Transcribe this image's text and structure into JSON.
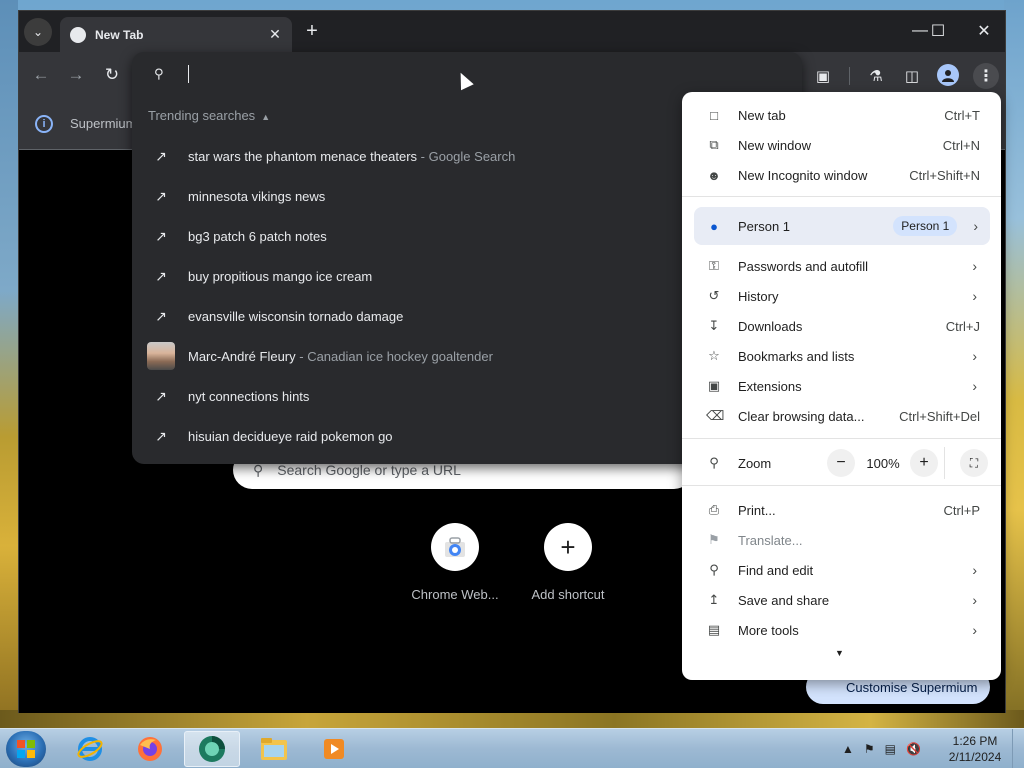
{
  "browser": {
    "tab": {
      "title": "New Tab"
    },
    "info_bar": {
      "text": "Supermium"
    },
    "colors": {
      "dark": "#202124",
      "toolbar": "#35363a",
      "accent": "#8ab4f8"
    }
  },
  "omnibox": {
    "trending_heading": "Trending searches",
    "suggestions": [
      {
        "icon": "trending-icon",
        "text": "star wars the phantom menace theaters",
        "sub": " - Google Search"
      },
      {
        "icon": "trending-icon",
        "text": "minnesota vikings news",
        "sub": ""
      },
      {
        "icon": "trending-icon",
        "text": "bg3 patch 6 patch notes",
        "sub": ""
      },
      {
        "icon": "trending-icon",
        "text": "buy propitious mango ice cream",
        "sub": ""
      },
      {
        "icon": "trending-icon",
        "text": "evansville wisconsin tornado damage",
        "sub": ""
      },
      {
        "icon": "person-thumbnail",
        "text": "Marc-André Fleury",
        "sub": " - Canadian ice hockey goaltender"
      },
      {
        "icon": "trending-icon",
        "text": "nyt connections hints",
        "sub": ""
      },
      {
        "icon": "trending-icon",
        "text": "hisuian decidueye raid pokemon go",
        "sub": ""
      }
    ]
  },
  "ntp": {
    "search_placeholder": "Search Google or type a URL",
    "shortcuts": [
      {
        "label": "Chrome Web..."
      },
      {
        "label": "Add shortcut"
      }
    ],
    "customise_label": "Customise Supermium"
  },
  "menu": {
    "items_top": [
      {
        "icon": "new-tab-icon",
        "label": "New tab",
        "shortcut": "Ctrl+T"
      },
      {
        "icon": "new-window-icon",
        "label": "New window",
        "shortcut": "Ctrl+N"
      },
      {
        "icon": "incognito-icon",
        "label": "New Incognito window",
        "shortcut": "Ctrl+Shift+N"
      }
    ],
    "person": {
      "label": "Person 1",
      "badge": "Person 1"
    },
    "items_mid": [
      {
        "icon": "key-icon",
        "label": "Passwords and autofill",
        "shortcut": ""
      },
      {
        "icon": "history-icon",
        "label": "History",
        "shortcut": ""
      },
      {
        "icon": "download-icon",
        "label": "Downloads",
        "shortcut": "Ctrl+J"
      },
      {
        "icon": "star-icon",
        "label": "Bookmarks and lists",
        "shortcut": ""
      },
      {
        "icon": "extension-icon",
        "label": "Extensions",
        "shortcut": ""
      },
      {
        "icon": "trash-icon",
        "label": "Clear browsing data...",
        "shortcut": "Ctrl+Shift+Del"
      }
    ],
    "zoom": {
      "label": "Zoom",
      "value": "100%"
    },
    "items_bottom": [
      {
        "icon": "print-icon",
        "label": "Print...",
        "shortcut": "Ctrl+P"
      },
      {
        "icon": "translate-icon",
        "label": "Translate...",
        "shortcut": ""
      },
      {
        "icon": "find-icon",
        "label": "Find and edit",
        "shortcut": ""
      },
      {
        "icon": "save-share-icon",
        "label": "Save and share",
        "shortcut": ""
      },
      {
        "icon": "toolbox-icon",
        "label": "More tools",
        "shortcut": ""
      }
    ]
  },
  "taskbar": {
    "time": "1:26 PM",
    "date": "2/11/2024"
  }
}
